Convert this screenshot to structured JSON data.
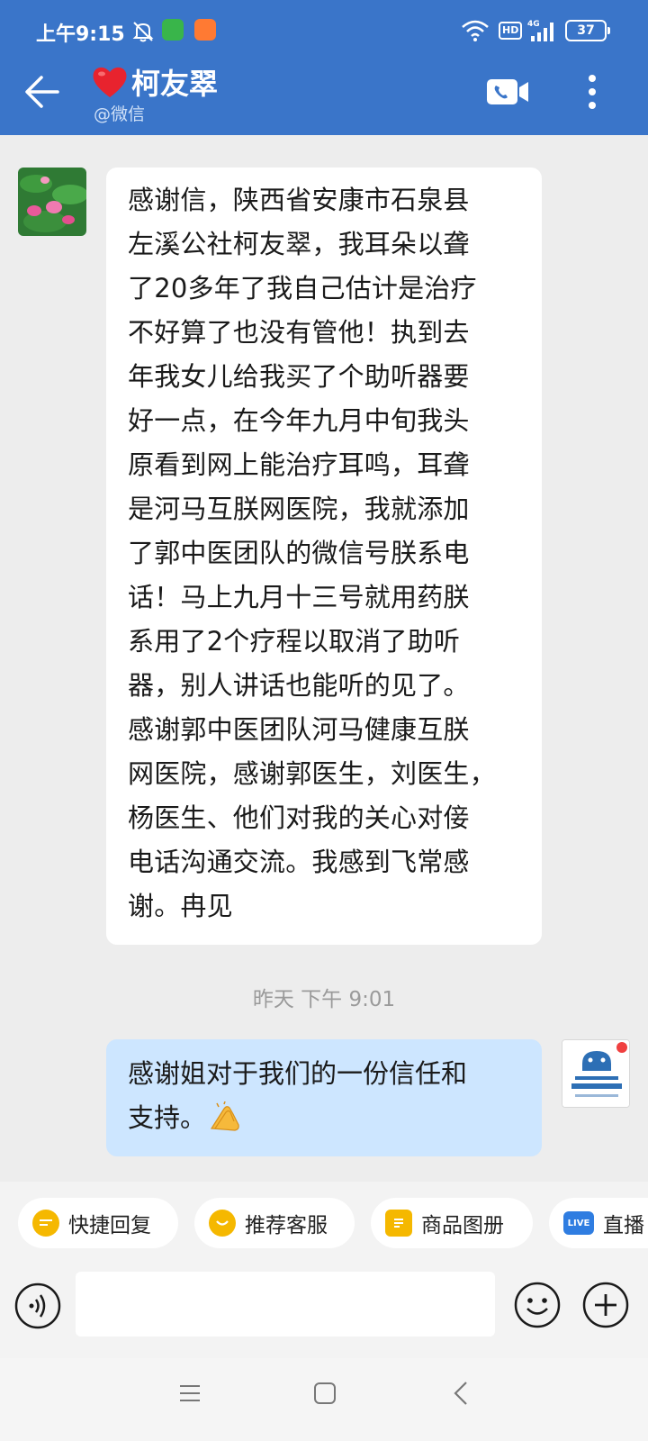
{
  "status_bar": {
    "time": "上午9:15",
    "network_badge": "HD",
    "network_type": "4G",
    "battery": "37",
    "icons": [
      "mute-icon",
      "app-icon-green",
      "app-icon-orange",
      "wifi-icon",
      "signal-icon",
      "battery-icon"
    ]
  },
  "header": {
    "name": "柯友翠",
    "subtitle": "@微信",
    "icons": [
      "back-arrow-icon",
      "heart-icon",
      "video-call-icon",
      "more-vertical-icon"
    ]
  },
  "messages": [
    {
      "side": "left",
      "text": "感谢信，陕西省安康市石泉县\n左溪公社柯友翠，我耳朵以聋\n了20多年了我自己估计是治疗\n不好算了也没有管他！执到去\n年我女儿给我买了个助听器要\n好一点，在今年九月中旬我头\n原看到网上能治疗耳鸣，耳聋\n是河马互朕网医院，我就添加\n了郭中医团队的微信号朕系电\n话！马上九月十三号就用药朕\n系用了2个疗程以取消了助听\n器，别人讲话也能听的见了。\n感谢郭中医团队河马健康互朕\n网医院，感谢郭医生，刘医生，\n杨医生、他们对我的关心对倿\n电话沟通交流。我感到飞常感\n谢。冉见"
    },
    {
      "side": "right",
      "text": "感谢姐对于我们的一份信任和\n支持。",
      "emoji": "clap-hands-icon"
    }
  ],
  "timestamp": "昨天  下午 9:01",
  "quick_actions": [
    {
      "label": "快捷回复",
      "icon": "quick-reply-icon",
      "color": "#f5b800"
    },
    {
      "label": "推荐客服",
      "icon": "recommend-service-icon",
      "color": "#f5b800"
    },
    {
      "label": "商品图册",
      "icon": "product-catalog-icon",
      "color": "#f5b800"
    },
    {
      "label": "直播",
      "icon": "live-icon",
      "icon_text": "LIVE",
      "color": "#2f7de1"
    }
  ],
  "input": {
    "value": "",
    "placeholder": ""
  },
  "colors": {
    "header": "#3a75c9",
    "bubble_left": "#ffffff",
    "bubble_right": "#cde6ff",
    "background": "#ededed"
  }
}
